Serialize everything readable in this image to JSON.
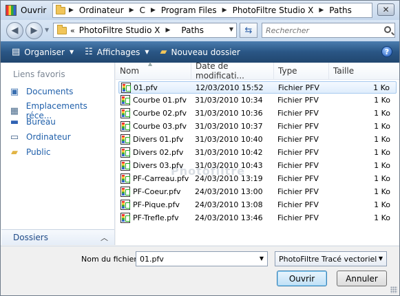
{
  "window": {
    "title": "Ouvrir"
  },
  "breadcrumb": [
    "Ordinateur",
    "C",
    "Program Files",
    "PhotoFiltre Studio X",
    "Paths"
  ],
  "address": {
    "prefix": "«",
    "parts": [
      "PhotoFiltre Studio X",
      "Paths"
    ]
  },
  "search": {
    "placeholder": "Rechercher"
  },
  "toolbar": {
    "organize": "Organiser",
    "views": "Affichages",
    "new_folder": "Nouveau dossier"
  },
  "sidebar": {
    "heading": "Liens favoris",
    "items": [
      {
        "label": "Documents",
        "icon": "documents-icon"
      },
      {
        "label": "Emplacements réce...",
        "icon": "recent-places-icon"
      },
      {
        "label": "Bureau",
        "icon": "desktop-icon"
      },
      {
        "label": "Ordinateur",
        "icon": "computer-icon"
      },
      {
        "label": "Public",
        "icon": "folder-icon"
      }
    ],
    "folders_label": "Dossiers"
  },
  "columns": [
    "Nom",
    "Date de modificati...",
    "Type",
    "Taille"
  ],
  "files": [
    {
      "name": "01.pfv",
      "date": "12/03/2010 15:52",
      "type": "Fichier PFV",
      "size": "1 Ko",
      "selected": true
    },
    {
      "name": "Courbe 01.pfv",
      "date": "31/03/2010 10:34",
      "type": "Fichier PFV",
      "size": "1 Ko"
    },
    {
      "name": "Courbe 02.pfv",
      "date": "31/03/2010 10:36",
      "type": "Fichier PFV",
      "size": "1 Ko"
    },
    {
      "name": "Courbe 03.pfv",
      "date": "31/03/2010 10:37",
      "type": "Fichier PFV",
      "size": "1 Ko"
    },
    {
      "name": "Divers 01.pfv",
      "date": "31/03/2010 10:40",
      "type": "Fichier PFV",
      "size": "1 Ko"
    },
    {
      "name": "Divers 02.pfv",
      "date": "31/03/2010 10:42",
      "type": "Fichier PFV",
      "size": "1 Ko"
    },
    {
      "name": "Divers 03.pfv",
      "date": "31/03/2010 10:43",
      "type": "Fichier PFV",
      "size": "1 Ko"
    },
    {
      "name": "PF-Carreau.pfv",
      "date": "24/03/2010 13:19",
      "type": "Fichier PFV",
      "size": "1 Ko"
    },
    {
      "name": "PF-Coeur.pfv",
      "date": "24/03/2010 13:00",
      "type": "Fichier PFV",
      "size": "1 Ko"
    },
    {
      "name": "PF-Pique.pfv",
      "date": "24/03/2010 13:08",
      "type": "Fichier PFV",
      "size": "1 Ko"
    },
    {
      "name": "PF-Trefle.pfv",
      "date": "24/03/2010 13:46",
      "type": "Fichier PFV",
      "size": "1 Ko"
    }
  ],
  "watermark": "Photofiltre",
  "filename": {
    "label": "Nom du fichier :",
    "value": "01.pfv"
  },
  "filetype": {
    "value": "PhotoFiltre Tracé vectoriel"
  },
  "buttons": {
    "open": "Ouvrir",
    "cancel": "Annuler"
  },
  "colors": {
    "accent": "#2a5685",
    "selection": "#dfedfc",
    "link": "#1f5faa"
  }
}
